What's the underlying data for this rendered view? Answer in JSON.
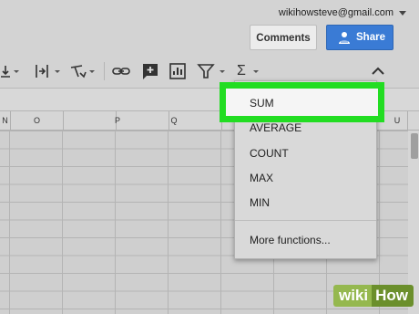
{
  "header": {
    "account_email": "wikihowsteve@gmail.com",
    "comments_label": "Comments",
    "share_label": "Share"
  },
  "toolbar": {
    "icons": [
      "align-bottom-icon",
      "text-wrap-icon",
      "text-rotate-icon",
      "link-icon",
      "comment-icon",
      "chart-icon",
      "filter-icon",
      "functions-icon",
      "collapse-icon"
    ],
    "functions_symbol": "Σ"
  },
  "columns": [
    "N",
    "O",
    "P",
    "Q",
    "U"
  ],
  "functions_menu": {
    "items": [
      "SUM",
      "AVERAGE",
      "COUNT",
      "MAX",
      "MIN"
    ],
    "more": "More functions..."
  },
  "highlight_color": "#22dd22",
  "watermark": {
    "wiki": "wiki",
    "how": "How"
  }
}
